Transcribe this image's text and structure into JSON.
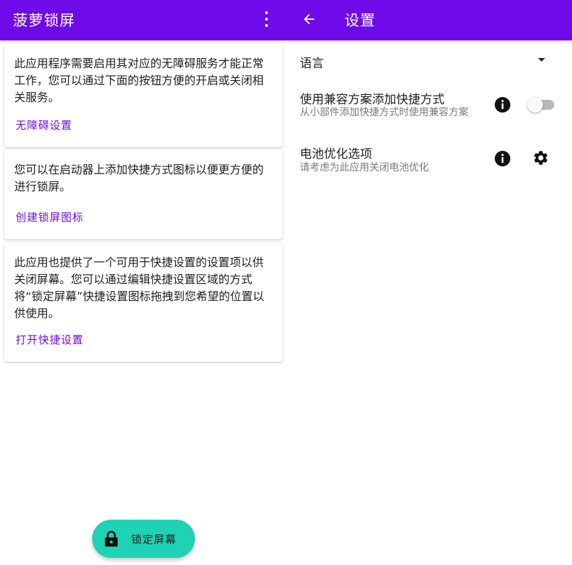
{
  "left_screen": {
    "app_title": "菠萝锁屏",
    "cards": [
      {
        "text": "此应用程序需要启用其对应的无障碍服务才能正常工作，您可以通过下面的按钮方便的开启或关闭相关服务。",
        "action": "无障碍设置"
      },
      {
        "text": "您可以在启动器上添加快捷方式图标以便更方便的进行锁屏。",
        "action": "创建锁屏图标"
      },
      {
        "text": "此应用也提供了一个可用于快捷设置的设置项以供关闭屏幕。您可以通过编辑快捷设置区域的方式将“锁定屏幕”快捷设置图标拖拽到您希望的位置以供使用。",
        "action": "打开快捷设置"
      }
    ],
    "fab_label": "锁定屏幕"
  },
  "right_screen": {
    "title": "设置",
    "language_label": "语言",
    "compat_title": "使用兼容方案添加快捷方式",
    "compat_subtitle": "从小部件添加快捷方式时使用兼容方案",
    "compat_toggle_on": false,
    "battery_title": "电池优化选项",
    "battery_subtitle": "请考虑为此应用关闭电池优化"
  },
  "colors": {
    "primary": "#6f0ae8",
    "accent_fab": "#20d2b4",
    "toggle_track_off": "#b8b8b8"
  },
  "icons": [
    "more-vert-icon",
    "back-arrow-icon",
    "dropdown-arrow-icon",
    "info-icon",
    "gear-icon",
    "lock-icon"
  ]
}
